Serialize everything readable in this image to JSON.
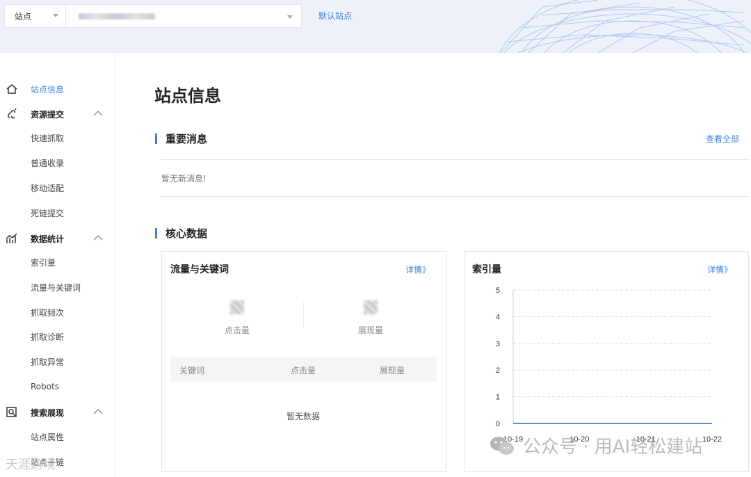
{
  "header": {
    "site_select_label": "站点",
    "default_site_label": "默认站点"
  },
  "sidebar": {
    "items": [
      {
        "label": "站点信息"
      },
      {
        "label": "资源提交"
      },
      {
        "label": "快速抓取"
      },
      {
        "label": "普通收录"
      },
      {
        "label": "移动适配"
      },
      {
        "label": "死链提交"
      },
      {
        "label": "数据统计"
      },
      {
        "label": "索引量"
      },
      {
        "label": "流量与关键词"
      },
      {
        "label": "抓取频次"
      },
      {
        "label": "抓取诊断"
      },
      {
        "label": "抓取异常"
      },
      {
        "label": "Robots"
      },
      {
        "label": "搜索展现"
      },
      {
        "label": "站点属性"
      },
      {
        "label": "站点子链"
      }
    ]
  },
  "main": {
    "page_title": "站点信息",
    "news": {
      "title": "重要消息",
      "view_all": "查看全部",
      "empty_text": "暂无新消息!"
    },
    "core": {
      "title": "核心数据"
    },
    "traffic_card": {
      "title": "流量与关键词",
      "detail_link": "详情》",
      "metrics": [
        {
          "name": "点击量"
        },
        {
          "name": "展现量"
        }
      ],
      "table_columns": [
        "关键词",
        "点击量",
        "展现量"
      ],
      "empty_text": "暂无数据"
    },
    "index_card": {
      "title": "索引量",
      "detail_link": "详情》"
    }
  },
  "chart_data": {
    "type": "line",
    "title": "索引量",
    "categories": [
      "10-19",
      "10-20",
      "10-21",
      "10-22"
    ],
    "series": [
      {
        "values": [
          0,
          0,
          0,
          0
        ]
      }
    ],
    "ylim": [
      0,
      5
    ],
    "yticks": [
      0,
      1,
      2,
      3,
      4,
      5
    ],
    "grid": true,
    "colors": {
      "line": "#5b8bd4",
      "grid": "#dcdcdc"
    }
  },
  "watermark": {
    "right_text": "公众号 · 用AI轻松建站",
    "left_text": "天涯跨境"
  },
  "colors": {
    "accent": "#3e7fd8",
    "topbar": "#eef1f9"
  }
}
